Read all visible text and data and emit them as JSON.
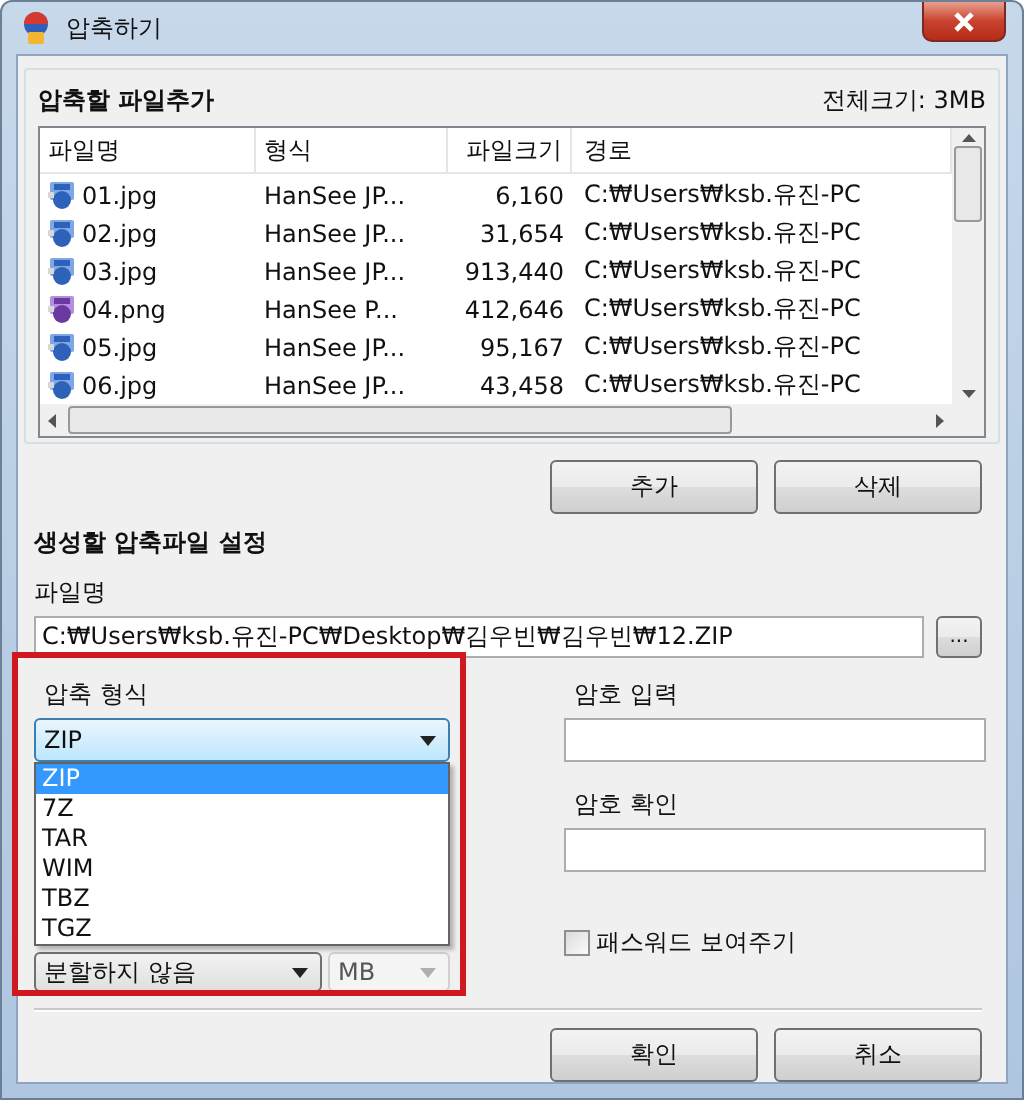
{
  "window": {
    "title": "압축하기"
  },
  "file_section": {
    "title": "압축할 파일추가",
    "total_size": "전체크기: 3MB",
    "columns": [
      "파일명",
      "형식",
      "파일크기",
      "경로"
    ],
    "rows": [
      {
        "kind": "jpg",
        "name": "01.jpg",
        "format": "HanSee JP...",
        "size": "6,160",
        "path": "C:₩Users₩ksb.유진-PC"
      },
      {
        "kind": "jpg",
        "name": "02.jpg",
        "format": "HanSee JP...",
        "size": "31,654",
        "path": "C:₩Users₩ksb.유진-PC"
      },
      {
        "kind": "jpg",
        "name": "03.jpg",
        "format": "HanSee JP...",
        "size": "913,440",
        "path": "C:₩Users₩ksb.유진-PC"
      },
      {
        "kind": "png",
        "name": "04.png",
        "format": "HanSee P...",
        "size": "412,646",
        "path": "C:₩Users₩ksb.유진-PC"
      },
      {
        "kind": "jpg",
        "name": "05.jpg",
        "format": "HanSee JP...",
        "size": "95,167",
        "path": "C:₩Users₩ksb.유진-PC"
      },
      {
        "kind": "jpg",
        "name": "06.jpg",
        "format": "HanSee JP...",
        "size": "43,458",
        "path": "C:₩Users₩ksb.유진-PC"
      }
    ],
    "buttons": [
      "추가",
      "삭제"
    ]
  },
  "settings": {
    "title": "생성할 압축파일 설정",
    "filename_label": "파일명",
    "filename_value": "C:₩Users₩ksb.유진-PC₩Desktop₩김우빈₩김우빈₩12.ZIP",
    "browse_button": "..."
  },
  "format": {
    "label": "압축 형식",
    "value": "ZIP",
    "expanded": true,
    "options": [
      {
        "label": "ZIP",
        "selected": true
      },
      {
        "label": "7Z",
        "selected": false
      },
      {
        "label": "TAR",
        "selected": false
      },
      {
        "label": "WIM",
        "selected": false
      },
      {
        "label": "TBZ",
        "selected": false
      },
      {
        "label": "TGZ",
        "selected": false
      }
    ]
  },
  "split": {
    "value": "분할하지 않음",
    "unit": "MB",
    "unit_disabled": true
  },
  "password": {
    "label": "암호 입력"
  },
  "password_confirm": {
    "label": "암호 확인"
  },
  "show_password": {
    "label": "패스워드 보여주기",
    "checked": false
  },
  "buttons": [
    "확인",
    "취소"
  ]
}
